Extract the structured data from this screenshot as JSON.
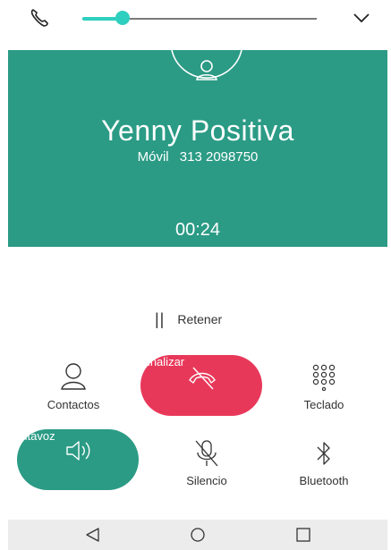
{
  "call": {
    "contact_name": "Yenny Positiva",
    "number_type": "Móvil",
    "number": "313 2098750",
    "duration": "00:24"
  },
  "volume": {
    "level": 0.17
  },
  "hold": {
    "label": "Retener"
  },
  "actions": {
    "contacts": "Contactos",
    "end_call": "Finalizar",
    "keypad": "Teclado",
    "speaker": "Altavoz",
    "mute": "Silencio",
    "bluetooth": "Bluetooth"
  },
  "colors": {
    "header_bg": "#2b9b85",
    "end_call_bg": "#e8385a",
    "speaker_bg": "#2b9b85",
    "slider_accent": "#2fcfbf"
  }
}
